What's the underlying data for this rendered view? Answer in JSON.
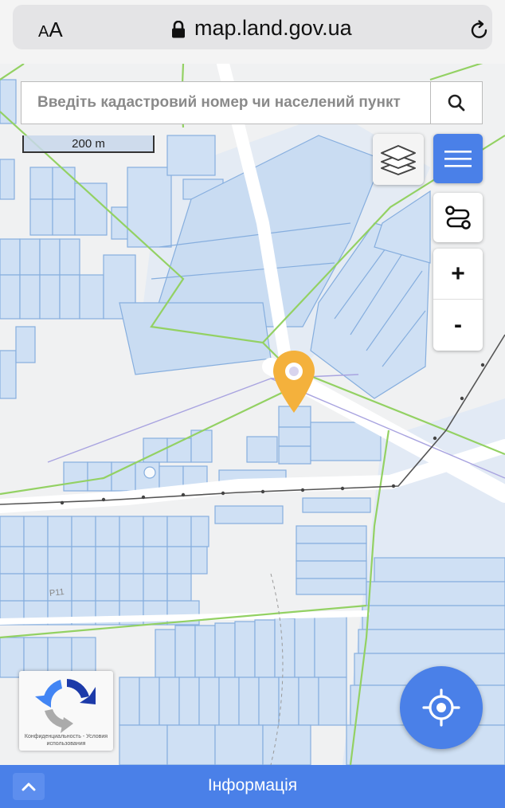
{
  "browser": {
    "text_size_label_small": "A",
    "text_size_label_large": "A",
    "url": "map.land.gov.ua"
  },
  "search": {
    "placeholder": "Введіть кадастровий номер чи населений пункт"
  },
  "scale": {
    "label": "200 m"
  },
  "map_labels": {
    "road_label": "Р11"
  },
  "recaptcha": {
    "text": "Конфиденциальность - Условия использования"
  },
  "zoom": {
    "in_label": "+",
    "out_label": "-"
  },
  "info_bar": {
    "label": "Інформація"
  },
  "colors": {
    "accent": "#4a80e8",
    "parcel_fill": "#cfe0f4",
    "parcel_stroke": "#7fa7d8",
    "boundary_green": "#8fcf5a",
    "pin": "#f4b13c"
  }
}
